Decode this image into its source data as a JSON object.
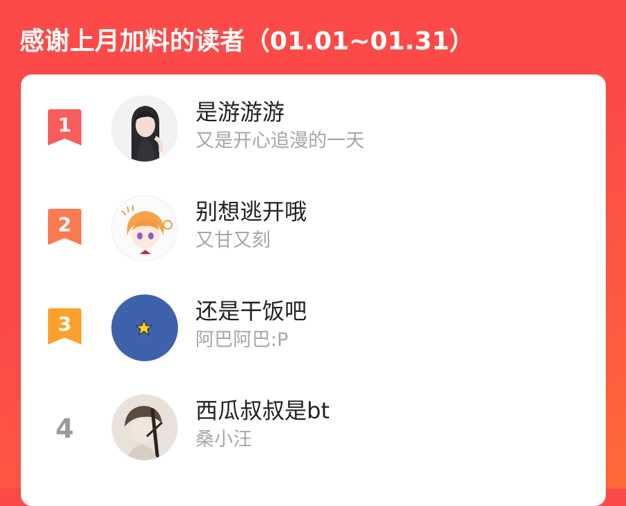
{
  "header": {
    "title": "感谢上月加料的读者（01.01~01.31）"
  },
  "readers": [
    {
      "rank": "1",
      "name": "是游游游",
      "subtitle": "又是开心追漫的一天",
      "badge_color": "#f95c5c",
      "avatar": "girl-portrait"
    },
    {
      "rank": "2",
      "name": "别想逃开哦",
      "subtitle": "又甘又刻",
      "badge_color": "#fb7a4f",
      "avatar": "orange-hair-chibi"
    },
    {
      "rank": "3",
      "name": "还是干饭吧",
      "subtitle": "阿巴阿巴:P",
      "badge_color": "#fca02c",
      "avatar": "blue-circle-star"
    },
    {
      "rank": "4",
      "name": "西瓜叔叔是bt",
      "subtitle": "桑小汪",
      "badge_color": "#9a9a9a",
      "avatar": "sketch-portrait"
    }
  ],
  "colors": {
    "background": "#fb4a48",
    "card": "#ffffff",
    "name_text": "#222222",
    "sub_text": "#a6a6a6"
  }
}
